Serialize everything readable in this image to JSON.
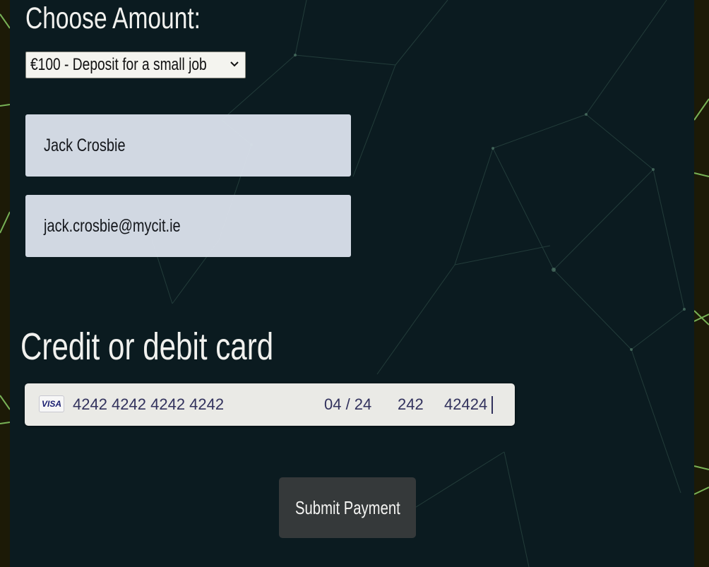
{
  "amount": {
    "heading": "Choose Amount:",
    "selected_option": "€100 - Deposit for a small job"
  },
  "form": {
    "name_value": "Jack Crosbie",
    "email_value": "jack.crosbie@mycit.ie"
  },
  "card": {
    "heading": "Credit or debit card",
    "brand_label": "VISA",
    "number": "4242 4242 4242 4242",
    "expiry": "04 / 24",
    "cvc": "242",
    "postal": "42424"
  },
  "actions": {
    "submit_label": "Submit Payment"
  },
  "colors": {
    "panel_background": "#0b1b20",
    "outer_background": "#1c1a07",
    "accent_line": "#7bd36a",
    "field_background": "#d8dfe9",
    "button_background": "#35393a"
  },
  "icons": {
    "select_arrow": "chevron-down-icon",
    "card_brand": "visa-icon"
  }
}
